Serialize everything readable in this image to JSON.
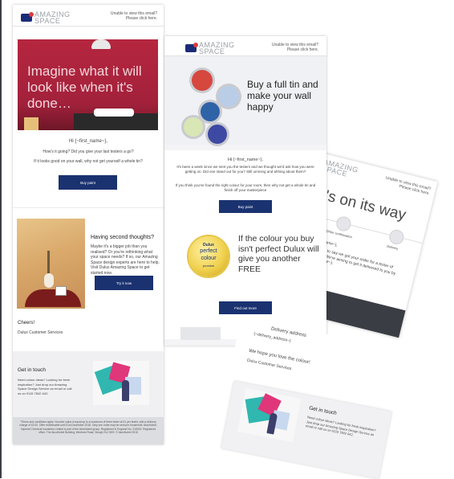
{
  "left_email": {
    "brand_small": "Dulux",
    "brand": "AMAZING SPACE",
    "header_note": "Unable to view this email? Please click here.",
    "hero_text": "Imagine what it will look like when it's done…",
    "greeting": "Hi {~first_name~},",
    "line1": "How's it going? Did you give your last testers a go?",
    "line2": "If it looks good on your wall, why not get yourself a whole tin?",
    "buy_button": "Buy paint",
    "second_title": "Having second thoughts?",
    "second_body": "Maybe it's a bigger job than you realised? Or you're rethinking what your space needs? If so, our Amazing Space design experts are here to help. Visit Dulux Amazing Space to get started now.",
    "try_button": "Try it now",
    "signoff": "Cheers!",
    "signature": "Dulux Customer Services",
    "contact_title": "Get in touch",
    "contact_body": "Need colour ideas? Looking for fresh inspiration? Just drop our Amazing Space Design Service an email or call us on 0115 7842 642.",
    "legal": "*Terms and conditions apply. Voucher value is equal up to a maximum of three tester at £1 per tester, with a delivery charge of £2.00. Offer redeemable until 31st December 2018. Only one order may be sent per household. AkzoNobel. Imperial Chemical Industries Limited is part of the AkzoNobel group. Registered in England No. 218019. Registered office: The AkzoNobel Building, Wexham Road, Slough SL2 5DS. © AkzoNobel 2018"
  },
  "mid_email": {
    "brand_small": "Dulux",
    "brand": "AMAZING SPACE",
    "header_note": "Unable to view this email? Please click here.",
    "headline": "Buy a full tin and make your wall happy",
    "greeting": "Hi {~first_name~},",
    "body1": "It's been a week since we sent you the testers and we thought we'd ask how you were getting on. Did one stand out for you? Still umming and ahhing about them?",
    "body2": "If you think you've found the right colour for your room, then why not get a whole tin and finish off your masterpiece",
    "buy_button": "Buy paint",
    "seal_line1": "Dulux",
    "seal_line2": "perfect",
    "seal_line3": "colour",
    "seal_line4": "promise",
    "free_text": "If the colour you buy isn't perfect Dulux will give you another FREE",
    "find_button": "Find out more",
    "tin_colors": [
      "#d6473e",
      "#b9cde6",
      "#2f63a8",
      "#d9e6b5",
      "#3e49a3"
    ]
  },
  "right_email": {
    "brand": "AMAZING SPACE",
    "header_note": "Unable to view this email? Please click here.",
    "title": "It's on its way",
    "step1": "Order confirmation",
    "step3": "Delivery",
    "greeting": "Hi {~first_name~},",
    "body": "We're happy to say we got your order for a tester of {~product~}. We're aiming to get it delivered to you by {~delivery_date~}."
  },
  "delivery_card": {
    "label": "Delivery address",
    "value": "{~delivery_address~}",
    "hope": "We hope you love the colour!",
    "signature": "Dulux Customer Services"
  },
  "bottom_card": {
    "contact_title": "Get in touch",
    "contact_body": "Need colour ideas? Looking for fresh inspiration? Just drop our Amazing Space Design Service an email or call us on 0115 7842 642."
  }
}
